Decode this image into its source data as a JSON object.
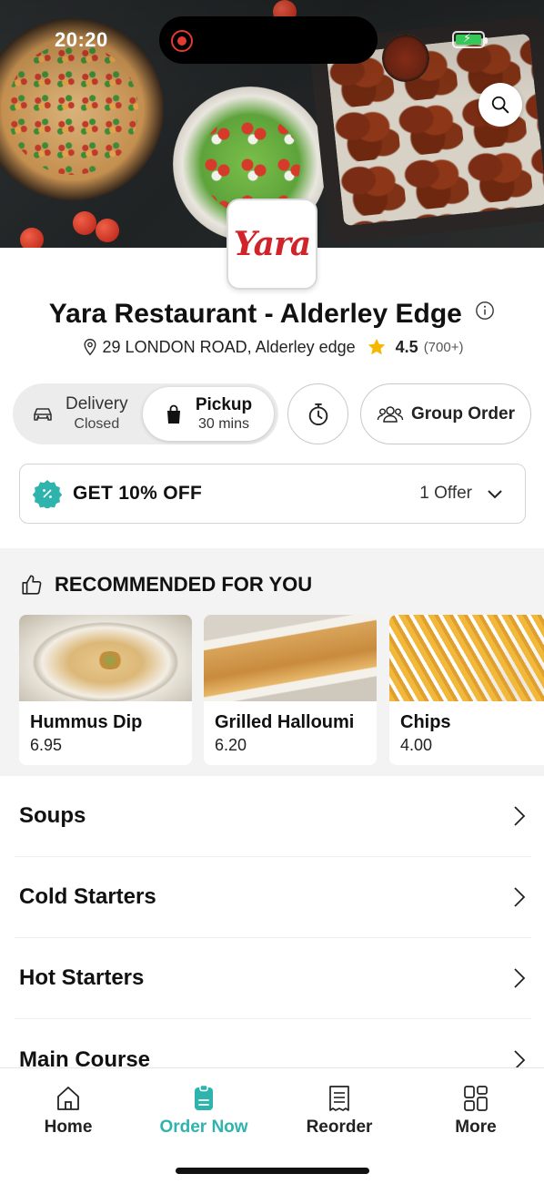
{
  "status_bar": {
    "time": "20:20"
  },
  "restaurant": {
    "logo_text": "Yara",
    "name": "Yara Restaurant - Alderley Edge",
    "address": "29 LONDON ROAD, Alderley edge",
    "rating": "4.5",
    "rating_count": "(700+)"
  },
  "order_mode": {
    "delivery_label": "Delivery",
    "delivery_status": "Closed",
    "pickup_label": "Pickup",
    "pickup_time": "30 mins",
    "selected": "pickup"
  },
  "group_order_label": "Group Order",
  "offer": {
    "title": "GET 10% OFF",
    "count": "1 Offer"
  },
  "recommended": {
    "heading": "RECOMMENDED FOR YOU",
    "items": [
      {
        "name": "Hummus Dip",
        "price": "6.95"
      },
      {
        "name": "Grilled Halloumi",
        "price": "6.20"
      },
      {
        "name": "Chips",
        "price": "4.00"
      }
    ]
  },
  "categories": [
    "Soups",
    "Cold Starters",
    "Hot Starters",
    "Main Course"
  ],
  "bottom_nav": {
    "items": [
      {
        "label": "Home",
        "icon": "home-icon"
      },
      {
        "label": "Order Now",
        "icon": "order-icon"
      },
      {
        "label": "Reorder",
        "icon": "receipt-icon"
      },
      {
        "label": "More",
        "icon": "grid-icon"
      }
    ],
    "active": "Order Now"
  },
  "colors": {
    "accent": "#2eb4ad",
    "brand_red": "#d0232a",
    "star": "#f5b800",
    "record": "#e53935"
  }
}
